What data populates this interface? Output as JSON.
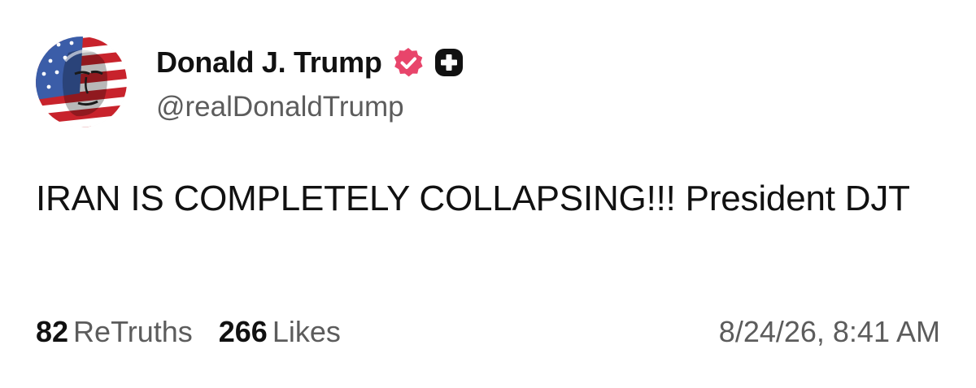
{
  "author": {
    "display_name": "Donald J. Trump",
    "handle": "@realDonaldTrump",
    "avatar_icon": "flag-portrait-avatar",
    "verified_icon": "verified-badge-icon",
    "extra_badge_icon": "plus-badge-icon"
  },
  "post": {
    "text": "IRAN IS COMPLETELY COLLAPSING!!! President DJT"
  },
  "stats": {
    "retruths_count": "82",
    "retruths_label": "ReTruths",
    "likes_count": "266",
    "likes_label": "Likes"
  },
  "timestamp": "8/24/26, 8:41 AM",
  "colors": {
    "verified": "#e8456b",
    "text_primary": "#111111",
    "text_secondary": "#5c5c5c",
    "flag_red": "#c8232c",
    "flag_blue": "#3b5da8"
  }
}
